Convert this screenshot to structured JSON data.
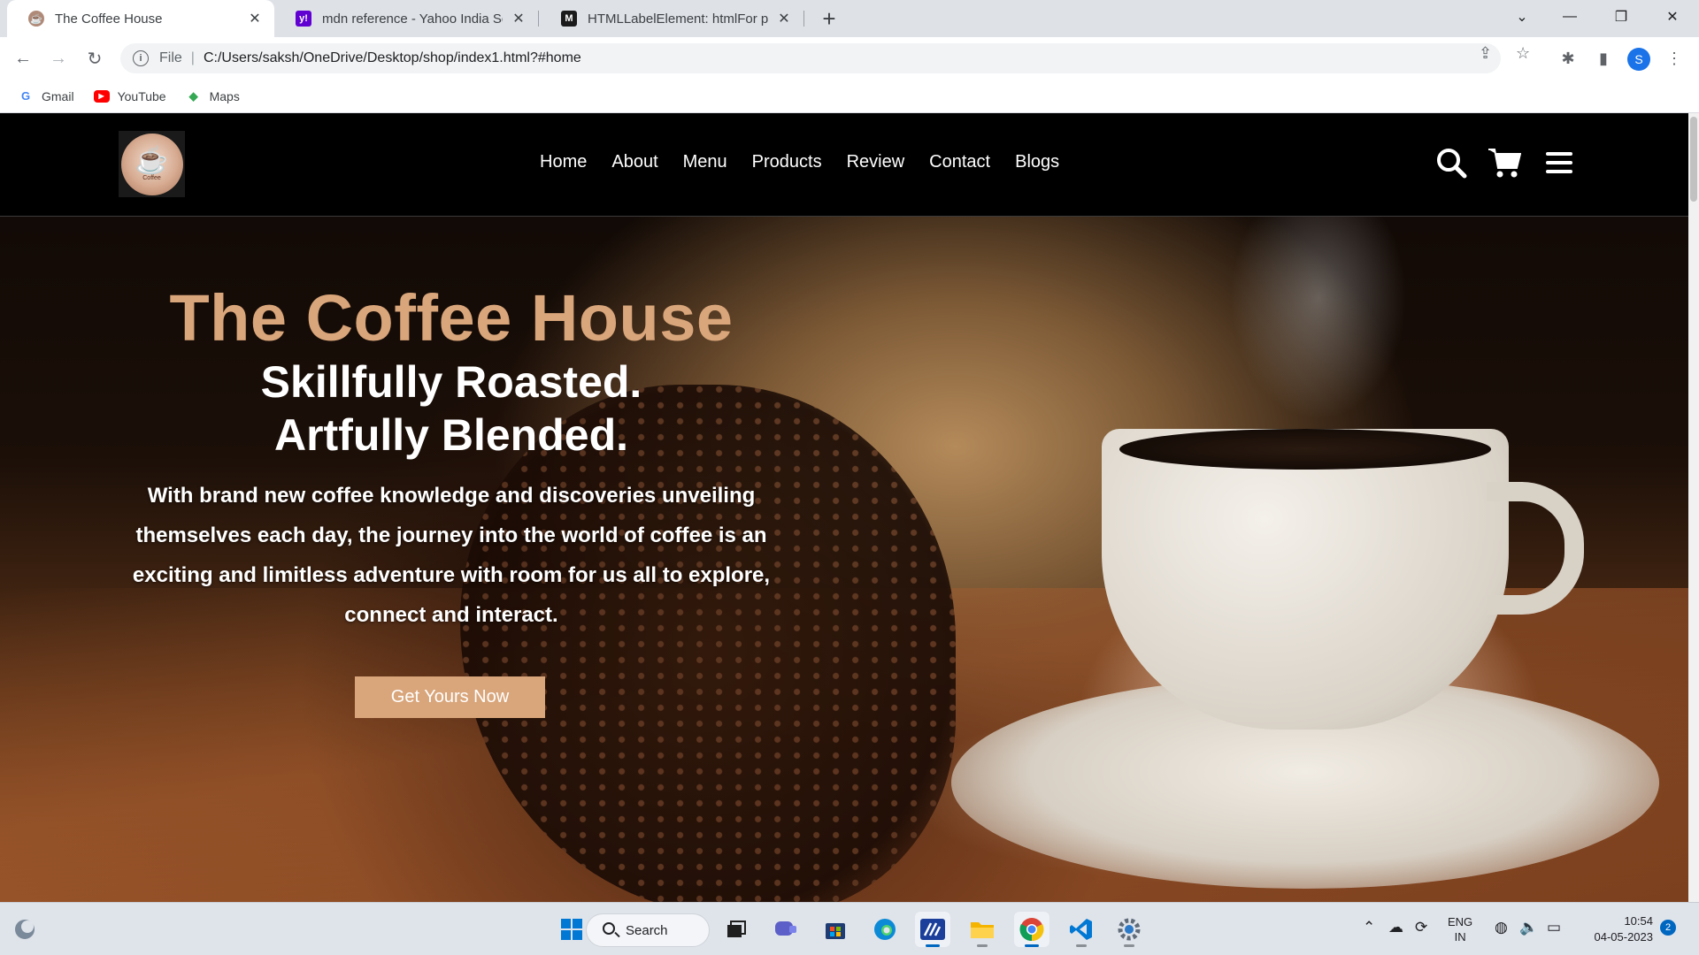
{
  "browser": {
    "tabs": [
      {
        "title": "The Coffee House",
        "active": true
      },
      {
        "title": "mdn reference - Yahoo India Sea",
        "active": false
      },
      {
        "title": "HTMLLabelElement: htmlFor prop",
        "active": false
      }
    ],
    "address": {
      "scheme_label": "File",
      "url": "C:/Users/saksh/OneDrive/Desktop/shop/index1.html?#home"
    },
    "profile_initial": "S",
    "bookmarks": [
      {
        "label": "Gmail",
        "icon": "google-icon"
      },
      {
        "label": "YouTube",
        "icon": "youtube-icon"
      },
      {
        "label": "Maps",
        "icon": "maps-icon"
      }
    ]
  },
  "site": {
    "logo_text": "Coffee",
    "nav": [
      "Home",
      "About",
      "Menu",
      "Products",
      "Review",
      "Contact",
      "Blogs"
    ],
    "header_icons": [
      "search-icon",
      "cart-icon",
      "menu-icon"
    ],
    "hero": {
      "title": "The Coffee House",
      "subtitle_line1": "Skillfully Roasted.",
      "subtitle_line2": "Artfully Blended.",
      "description": "With brand new coffee knowledge and discoveries unveiling themselves each day, the journey into the world of coffee is an exciting and limitless adventure with room for us all to explore, connect and interact.",
      "cta_label": "Get Yours Now"
    },
    "colors": {
      "accent": "#d9a57a",
      "header_bg": "#000000"
    }
  },
  "taskbar": {
    "search_label": "Search",
    "apps": [
      "widgets-icon",
      "start-icon",
      "task-view-icon",
      "teams-icon",
      "store-icon",
      "edge-icon",
      "mdn-app-icon",
      "file-explorer-icon",
      "chrome-icon",
      "vscode-icon",
      "settings-icon"
    ],
    "language_line1": "ENG",
    "language_line2": "IN",
    "time": "10:54",
    "date": "04-05-2023",
    "notification_count": "2"
  }
}
